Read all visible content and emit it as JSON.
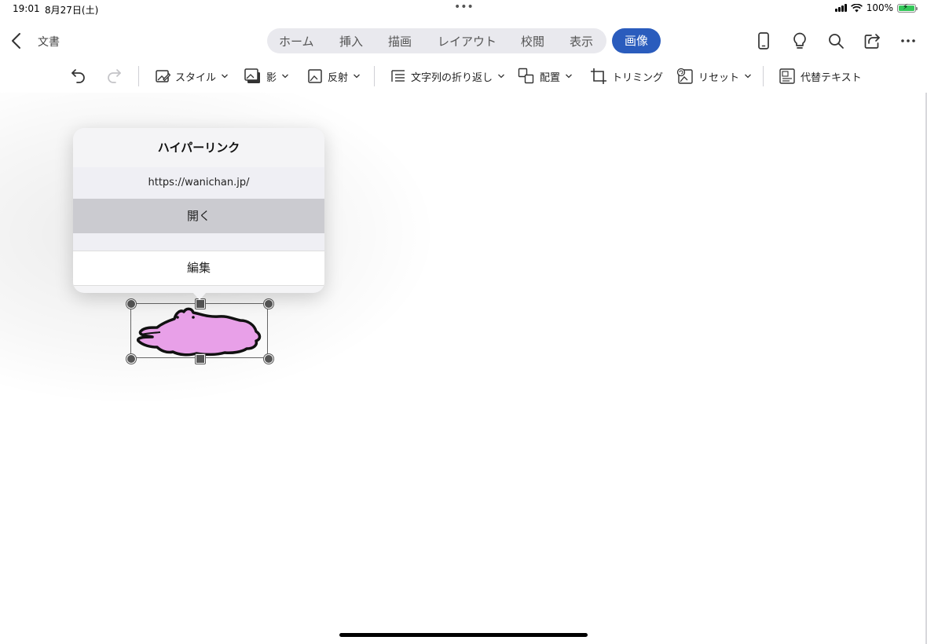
{
  "status": {
    "time": "19:01",
    "date": "8月27日(土)",
    "dots": "•••",
    "battery": "100%"
  },
  "header": {
    "document_title": "文書",
    "tabs": [
      "ホーム",
      "挿入",
      "描画",
      "レイアウト",
      "校閲",
      "表示"
    ],
    "active_tab": "画像"
  },
  "ribbon": {
    "style": "スタイル",
    "shadow": "影",
    "reflection": "反射",
    "wrap_text": "文字列の折り返し",
    "arrange": "配置",
    "crop": "トリミング",
    "reset": "リセット",
    "alt_text": "代替テキスト"
  },
  "popover": {
    "title": "ハイパーリンク",
    "url": "https://wanichan.jp/",
    "open_label": "開く",
    "edit_label": "編集"
  },
  "colors": {
    "accent": "#2a5cbd",
    "crocodile_fill": "#e8a0e8",
    "battery": "#34c759"
  }
}
